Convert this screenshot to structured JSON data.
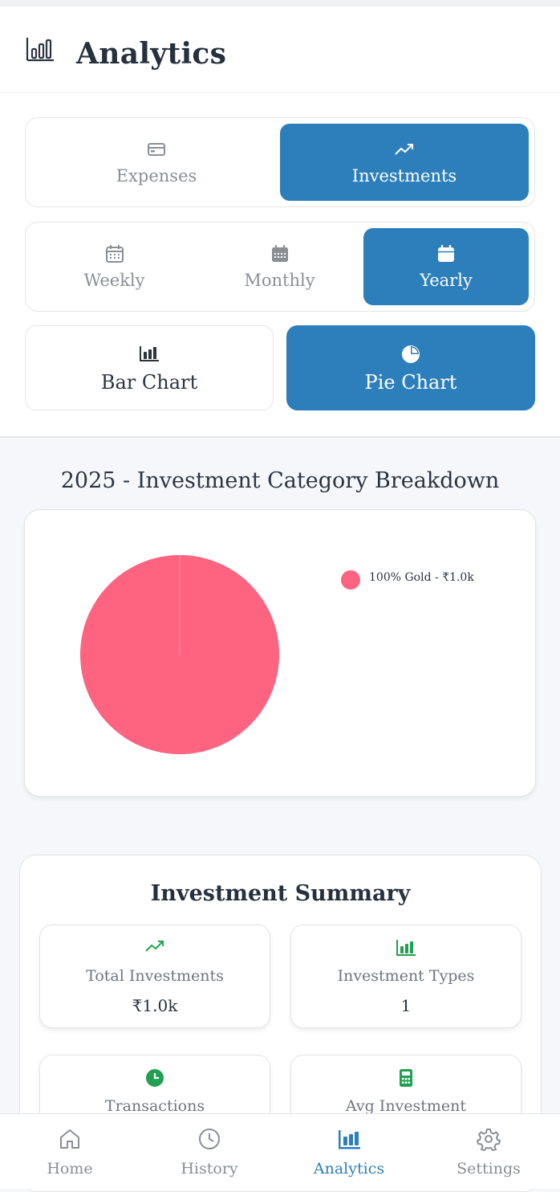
{
  "header": {
    "title": "Analytics"
  },
  "type_toggle": [
    {
      "label": "Expenses",
      "icon": "credit-card-icon",
      "active": false
    },
    {
      "label": "Investments",
      "icon": "trending-up-icon",
      "active": true
    }
  ],
  "period_toggle": [
    {
      "label": "Weekly",
      "icon": "calendar-week-icon",
      "active": false
    },
    {
      "label": "Monthly",
      "icon": "calendar-month-icon",
      "active": false
    },
    {
      "label": "Yearly",
      "icon": "calendar-year-icon",
      "active": true
    }
  ],
  "chart_toggle": [
    {
      "label": "Bar Chart",
      "icon": "bar-chart-icon",
      "active": false
    },
    {
      "label": "Pie Chart",
      "icon": "pie-chart-icon",
      "active": true
    }
  ],
  "breakdown": {
    "title": "2025 - Investment Category Breakdown"
  },
  "chart_data": {
    "type": "pie",
    "slices": [
      {
        "label": "Gold",
        "value": 1000,
        "percent": 100,
        "color": "#fe6380"
      }
    ],
    "legend": [
      "100% Gold - ₹1.0k"
    ],
    "legend_placement": "top-right"
  },
  "summary": {
    "title": "Investment Summary",
    "stats": [
      {
        "label": "Total Investments",
        "value": "₹1.0k",
        "icon": "trending-up-icon"
      },
      {
        "label": "Investment Types",
        "value": "1",
        "icon": "bar-chart-icon"
      },
      {
        "label": "Transactions",
        "value": "",
        "icon": "clock-icon"
      },
      {
        "label": "Avg Investment",
        "value": "",
        "icon": "calculator-icon"
      }
    ]
  },
  "nav": [
    {
      "label": "Home",
      "icon": "home-icon",
      "active": false
    },
    {
      "label": "History",
      "icon": "clock-icon",
      "active": false
    },
    {
      "label": "Analytics",
      "icon": "bar-chart-icon",
      "active": true
    },
    {
      "label": "Settings",
      "icon": "gear-icon",
      "active": false
    }
  ],
  "colors": {
    "accent": "#2c7fbb",
    "pie": "#fe6380",
    "green": "#22a052"
  }
}
